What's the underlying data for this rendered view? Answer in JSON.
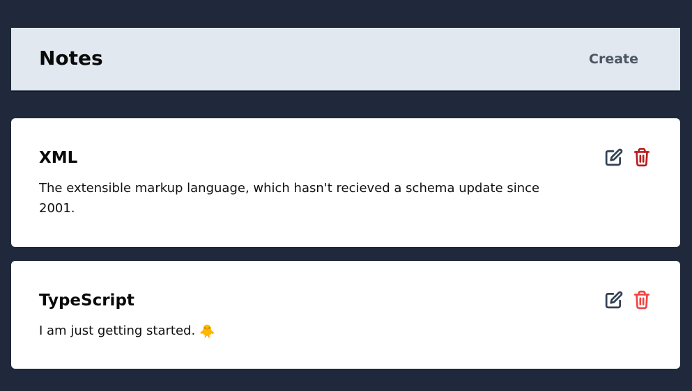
{
  "header": {
    "title": "Notes",
    "create_label": "Create"
  },
  "notes": [
    {
      "title": "XML",
      "body": "The extensible markup language, which hasn't recieved a schema update since 2001.",
      "emoji": "",
      "icons": {
        "edit": "edit-icon",
        "delete": "trash-icon"
      },
      "delete_color": "#b91c1c"
    },
    {
      "title": "TypeScript",
      "body": "I am just getting started.",
      "emoji": "🐥",
      "icons": {
        "edit": "edit-icon",
        "delete": "trash-icon"
      },
      "delete_color": "#ef4444"
    }
  ],
  "colors": {
    "background": "#1f293b",
    "header": "#e2e8f0",
    "card": "#ffffff",
    "edit_icon": "#334155"
  }
}
